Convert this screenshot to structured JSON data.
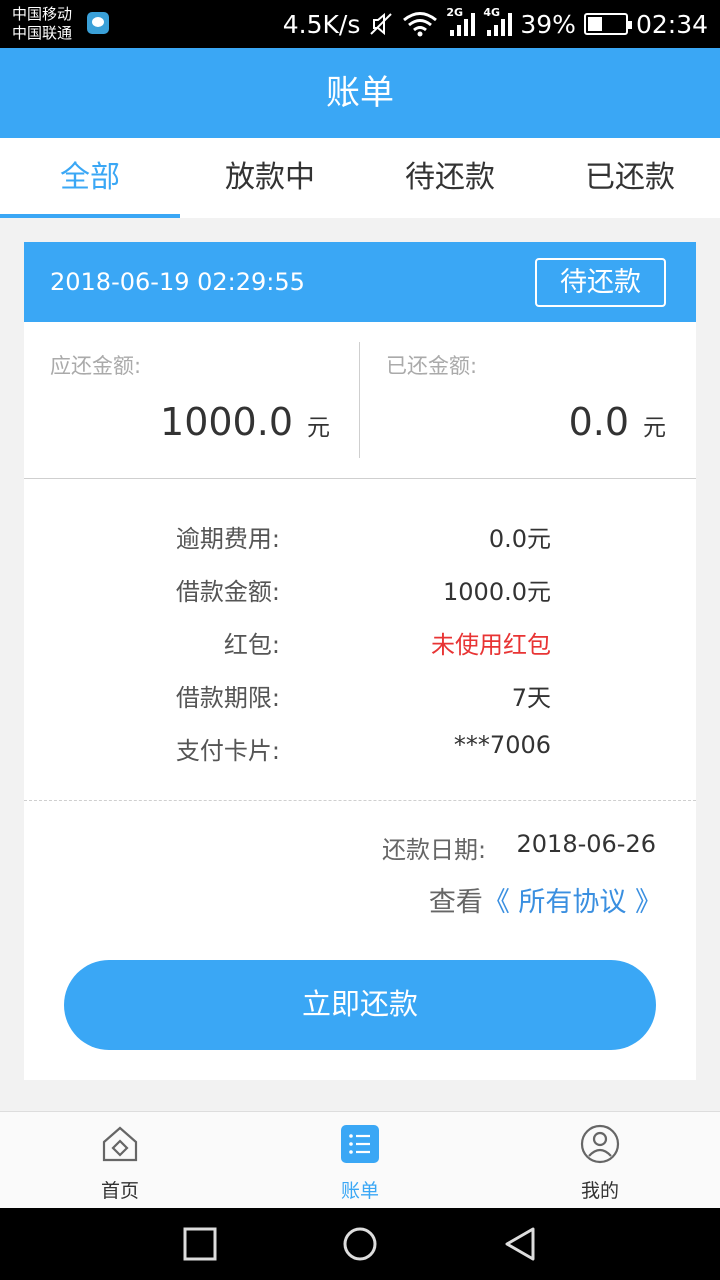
{
  "status_bar": {
    "carrier1": "中国移动",
    "carrier2": "中国联通",
    "speed": "4.5K/s",
    "sig1_tag": "2G",
    "sig2_tag": "4G",
    "battery": "39%",
    "time": "02:34"
  },
  "header": {
    "title": "账单"
  },
  "tabs": [
    {
      "label": "全部",
      "active": true
    },
    {
      "label": "放款中",
      "active": false
    },
    {
      "label": "待还款",
      "active": false
    },
    {
      "label": "已还款",
      "active": false
    }
  ],
  "bill": {
    "datetime": "2018-06-19 02:29:55",
    "status": "待还款",
    "due_amount": {
      "label": "应还金额:",
      "value": "1000.0",
      "unit": "元"
    },
    "paid_amount": {
      "label": "已还金额:",
      "value": "0.0",
      "unit": "元"
    },
    "details": [
      {
        "label": "逾期费用:",
        "value": "0.0元"
      },
      {
        "label": "借款金额:",
        "value": "1000.0元"
      },
      {
        "label": "红包:",
        "value": "未使用红包"
      },
      {
        "label": "借款期限:",
        "value": "7天"
      },
      {
        "label": "支付卡片:",
        "value": "***7006"
      }
    ],
    "due_date_label": "还款日期:",
    "due_date": "2018-06-26",
    "agreement_prefix": "查看",
    "agreement_link": "《 所有协议 》",
    "repay_button": "立即还款"
  },
  "bottom_nav": [
    {
      "label": "首页",
      "icon": "home-icon"
    },
    {
      "label": "账单",
      "icon": "bill-list-icon"
    },
    {
      "label": "我的",
      "icon": "profile-icon"
    }
  ],
  "colors": {
    "accent": "#3aa7f5",
    "red": "#e83434",
    "link": "#3a8fe0"
  }
}
